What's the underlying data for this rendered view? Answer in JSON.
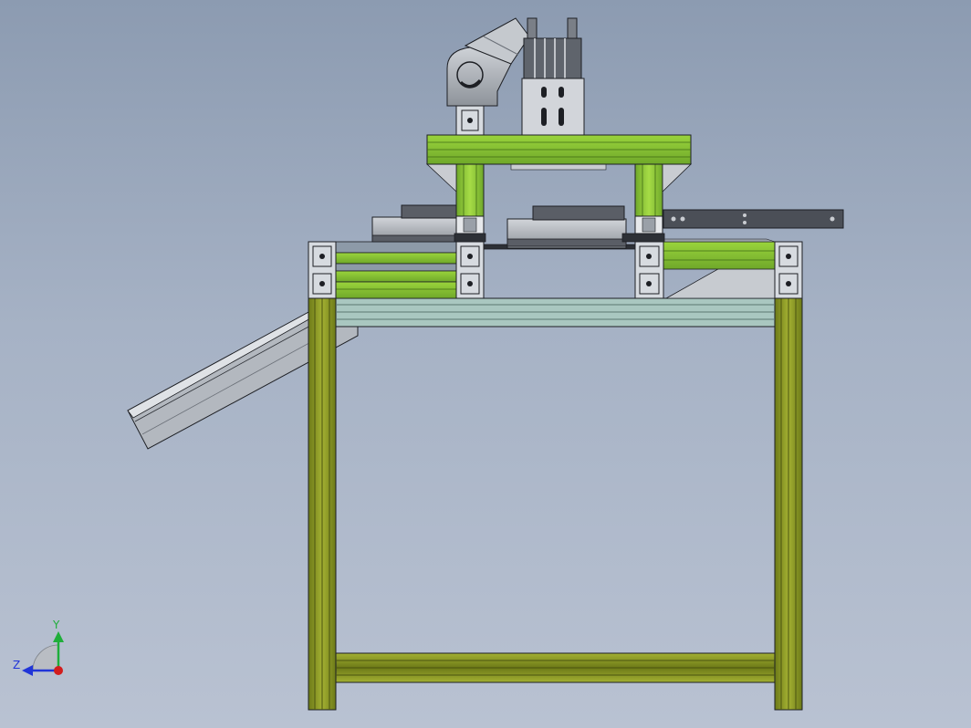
{
  "scene": {
    "type": "cad-assembly-front-view",
    "colors": {
      "background_top": "#8c9bb1",
      "background_bottom": "#b9c2d2",
      "frame_olive": "#8c9a2a",
      "frame_olive_dark": "#5e6a12",
      "frame_green": "#8cc832",
      "rail_teal": "#9fc0b8",
      "gray_part": "#b8bcc2",
      "dark_part": "#5a5e66",
      "outline": "#1d1f24"
    }
  },
  "triad": {
    "y_label": "Y",
    "z_label": "Z",
    "y_color": "#1fae3a",
    "z_color": "#2035d8",
    "x_color": "#d21d1d"
  }
}
